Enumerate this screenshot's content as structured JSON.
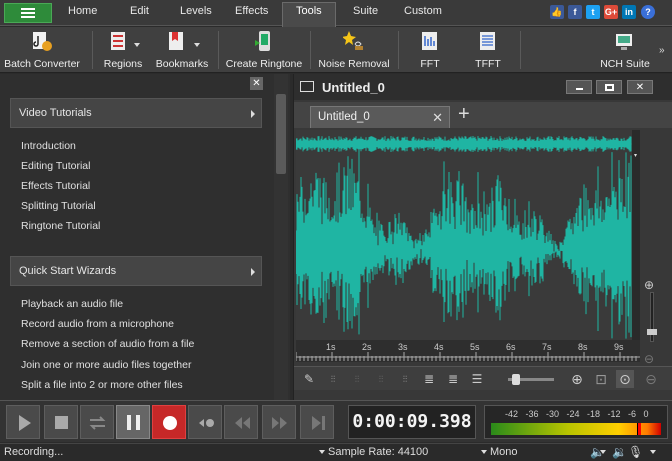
{
  "menu": {
    "tabs": [
      "Home",
      "Edit",
      "Levels",
      "Effects",
      "Tools",
      "Suite",
      "Custom"
    ],
    "active_tab": "Tools"
  },
  "social": [
    {
      "name": "like-icon",
      "glyph": "👍",
      "color": "#3b5998"
    },
    {
      "name": "facebook-icon",
      "glyph": "f",
      "color": "#3b5998"
    },
    {
      "name": "twitter-icon",
      "glyph": "t",
      "color": "#1da1f2"
    },
    {
      "name": "google-plus-icon",
      "glyph": "G+",
      "color": "#dd4b39"
    },
    {
      "name": "linkedin-icon",
      "glyph": "in",
      "color": "#0077b5"
    },
    {
      "name": "help-icon",
      "glyph": "?",
      "color": "#3a6fd8"
    }
  ],
  "toolbar": {
    "batch_converter": "Batch Converter",
    "regions": "Regions",
    "bookmarks": "Bookmarks",
    "create_ringtone": "Create Ringtone",
    "noise_removal": "Noise Removal",
    "fft": "FFT",
    "tfft": "TFFT",
    "nch_suite": "NCH Suite"
  },
  "left_panel": {
    "video_tutorials": {
      "header": "Video Tutorials",
      "items": [
        "Introduction",
        "Editing Tutorial",
        "Effects Tutorial",
        "Splitting Tutorial",
        "Ringtone Tutorial"
      ]
    },
    "quick_start": {
      "header": "Quick Start Wizards",
      "items": [
        "Playback an audio file",
        "Record audio from a microphone",
        "Remove a section of audio from a file",
        "Join one or more audio files together",
        "Split a file into 2 or more other files"
      ]
    }
  },
  "editor": {
    "title": "Untitled_0",
    "tab_label": "Untitled_0",
    "wave_color": "#1fb5a3",
    "ruler_labels": [
      "1s",
      "2s",
      "3s",
      "4s",
      "5s",
      "6s",
      "7s",
      "8s",
      "9s"
    ]
  },
  "transport": {
    "time": "0:00:09.398",
    "meter_scale": "-42 -36 -30 -24 -18 -12 -6 0"
  },
  "status": {
    "left": "Recording...",
    "sample_rate": "Sample Rate: 44100",
    "channels": "Mono"
  }
}
